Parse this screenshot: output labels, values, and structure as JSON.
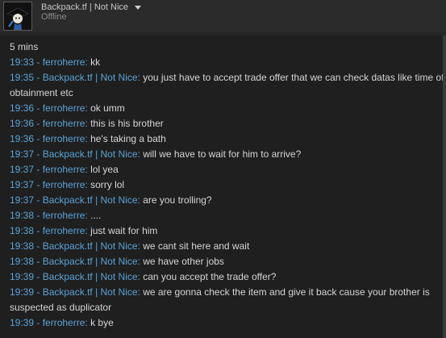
{
  "header": {
    "user_name": "Backpack.tf | Not Nice",
    "status": "Offline"
  },
  "chat": {
    "time_label": "5 mins",
    "messages": [
      {
        "time": "19:33",
        "sender": "ferroherre",
        "text": "kk"
      },
      {
        "time": "19:35",
        "sender": "Backpack.tf | Not Nice",
        "text": "you just have to accept trade offer that we can check datas like time of obtainment etc"
      },
      {
        "time": "19:36",
        "sender": "ferroherre",
        "text": "ok umm"
      },
      {
        "time": "19:36",
        "sender": "ferroherre",
        "text": "this is his brother"
      },
      {
        "time": "19:36",
        "sender": "ferroherre",
        "text": "he's taking a bath"
      },
      {
        "time": "19:37",
        "sender": "Backpack.tf | Not Nice",
        "text": "will we have to wait for him to arrive?"
      },
      {
        "time": "19:37",
        "sender": "ferroherre",
        "text": "lol yea"
      },
      {
        "time": "19:37",
        "sender": "ferroherre",
        "text": "sorry lol"
      },
      {
        "time": "19:37",
        "sender": "Backpack.tf | Not Nice",
        "text": "are you trolling?"
      },
      {
        "time": "19:38",
        "sender": "ferroherre",
        "text": "...."
      },
      {
        "time": "19:38",
        "sender": "ferroherre",
        "text": "just wait for him"
      },
      {
        "time": "19:38",
        "sender": "Backpack.tf | Not Nice",
        "text": "we cant sit here and wait"
      },
      {
        "time": "19:38",
        "sender": "Backpack.tf | Not Nice",
        "text": "we have other jobs"
      },
      {
        "time": "19:39",
        "sender": "Backpack.tf | Not Nice",
        "text": "can you accept the trade offer?"
      },
      {
        "time": "19:39",
        "sender": "Backpack.tf | Not Nice",
        "text": "we are gonna check the item and give it back cause your brother is suspected as duplicator"
      },
      {
        "time": "19:39",
        "sender": "ferroherre",
        "text": "k bye"
      }
    ]
  }
}
